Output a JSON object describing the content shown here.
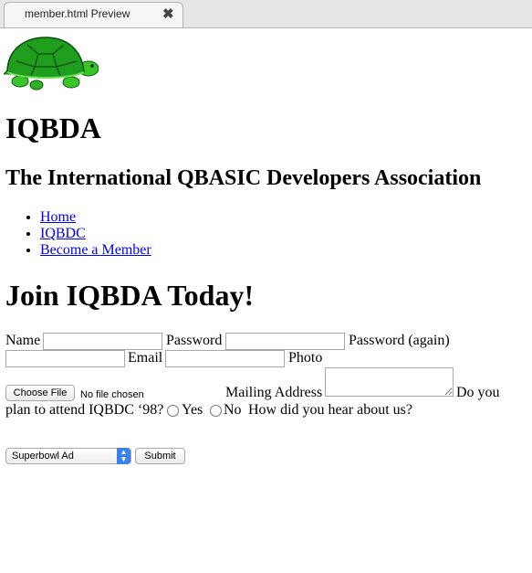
{
  "browser": {
    "tab_title": "member.html Preview",
    "close_glyph": "✖"
  },
  "site": {
    "title": "IQBDA",
    "subtitle": "The International QBASIC Developers Association",
    "logo_icon": "turtle-icon"
  },
  "nav": {
    "items": [
      {
        "label": "Home"
      },
      {
        "label": "IQBDC"
      },
      {
        "label": "Become a Member"
      }
    ]
  },
  "join": {
    "title": "Join IQBDA Today!"
  },
  "form": {
    "name_label": "Name",
    "password_label": "Password",
    "password_again_label": "Password (again)",
    "email_label": "Email",
    "photo_label": "Photo",
    "choose_file_label": "Choose File",
    "no_file_text": "No file chosen",
    "mailing_address_label": "Mailing Address",
    "attend_question_part1": "Do you",
    "attend_question_part2": "plan to attend IQBDC ‘98?",
    "yes_label": "Yes",
    "no_label": "No",
    "hear_question": "How did you hear about us?",
    "hear_selected": "Superbowl Ad",
    "submit_label": "Submit"
  },
  "colors": {
    "link": "#0000ee",
    "select_arrow_bg": "#3d82ea",
    "turtle_shell": "#1f9d1f",
    "turtle_body": "#39c42a"
  }
}
